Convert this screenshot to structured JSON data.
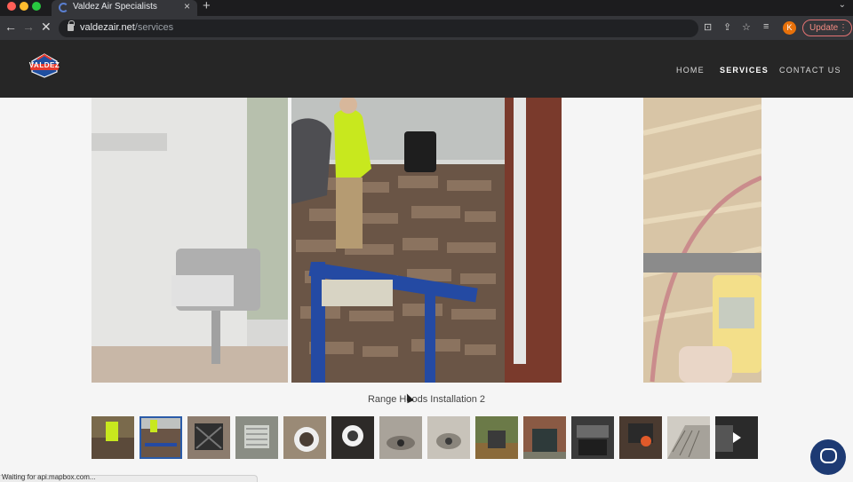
{
  "browser": {
    "tab_title": "Valdez Air Specialists",
    "new_tab": "+",
    "close_tab": "×",
    "url_domain": "valdezair.net",
    "url_path": "/services",
    "profile_initial": "K",
    "update_label": "Update",
    "status_text": "Waiting for api.mapbox.com..."
  },
  "site": {
    "logo_text": "VALDEZ",
    "nav": [
      {
        "label": "HOME"
      },
      {
        "label": "SERVICES"
      },
      {
        "label": "CONTACT US"
      }
    ]
  },
  "gallery": {
    "caption": "Range Hoods Installation 2",
    "active_thumb": 2,
    "thumb_count": 14
  },
  "colors": {
    "header_bg": "#262626",
    "accent": "#2a5ba8",
    "chat": "#1d3a73"
  }
}
